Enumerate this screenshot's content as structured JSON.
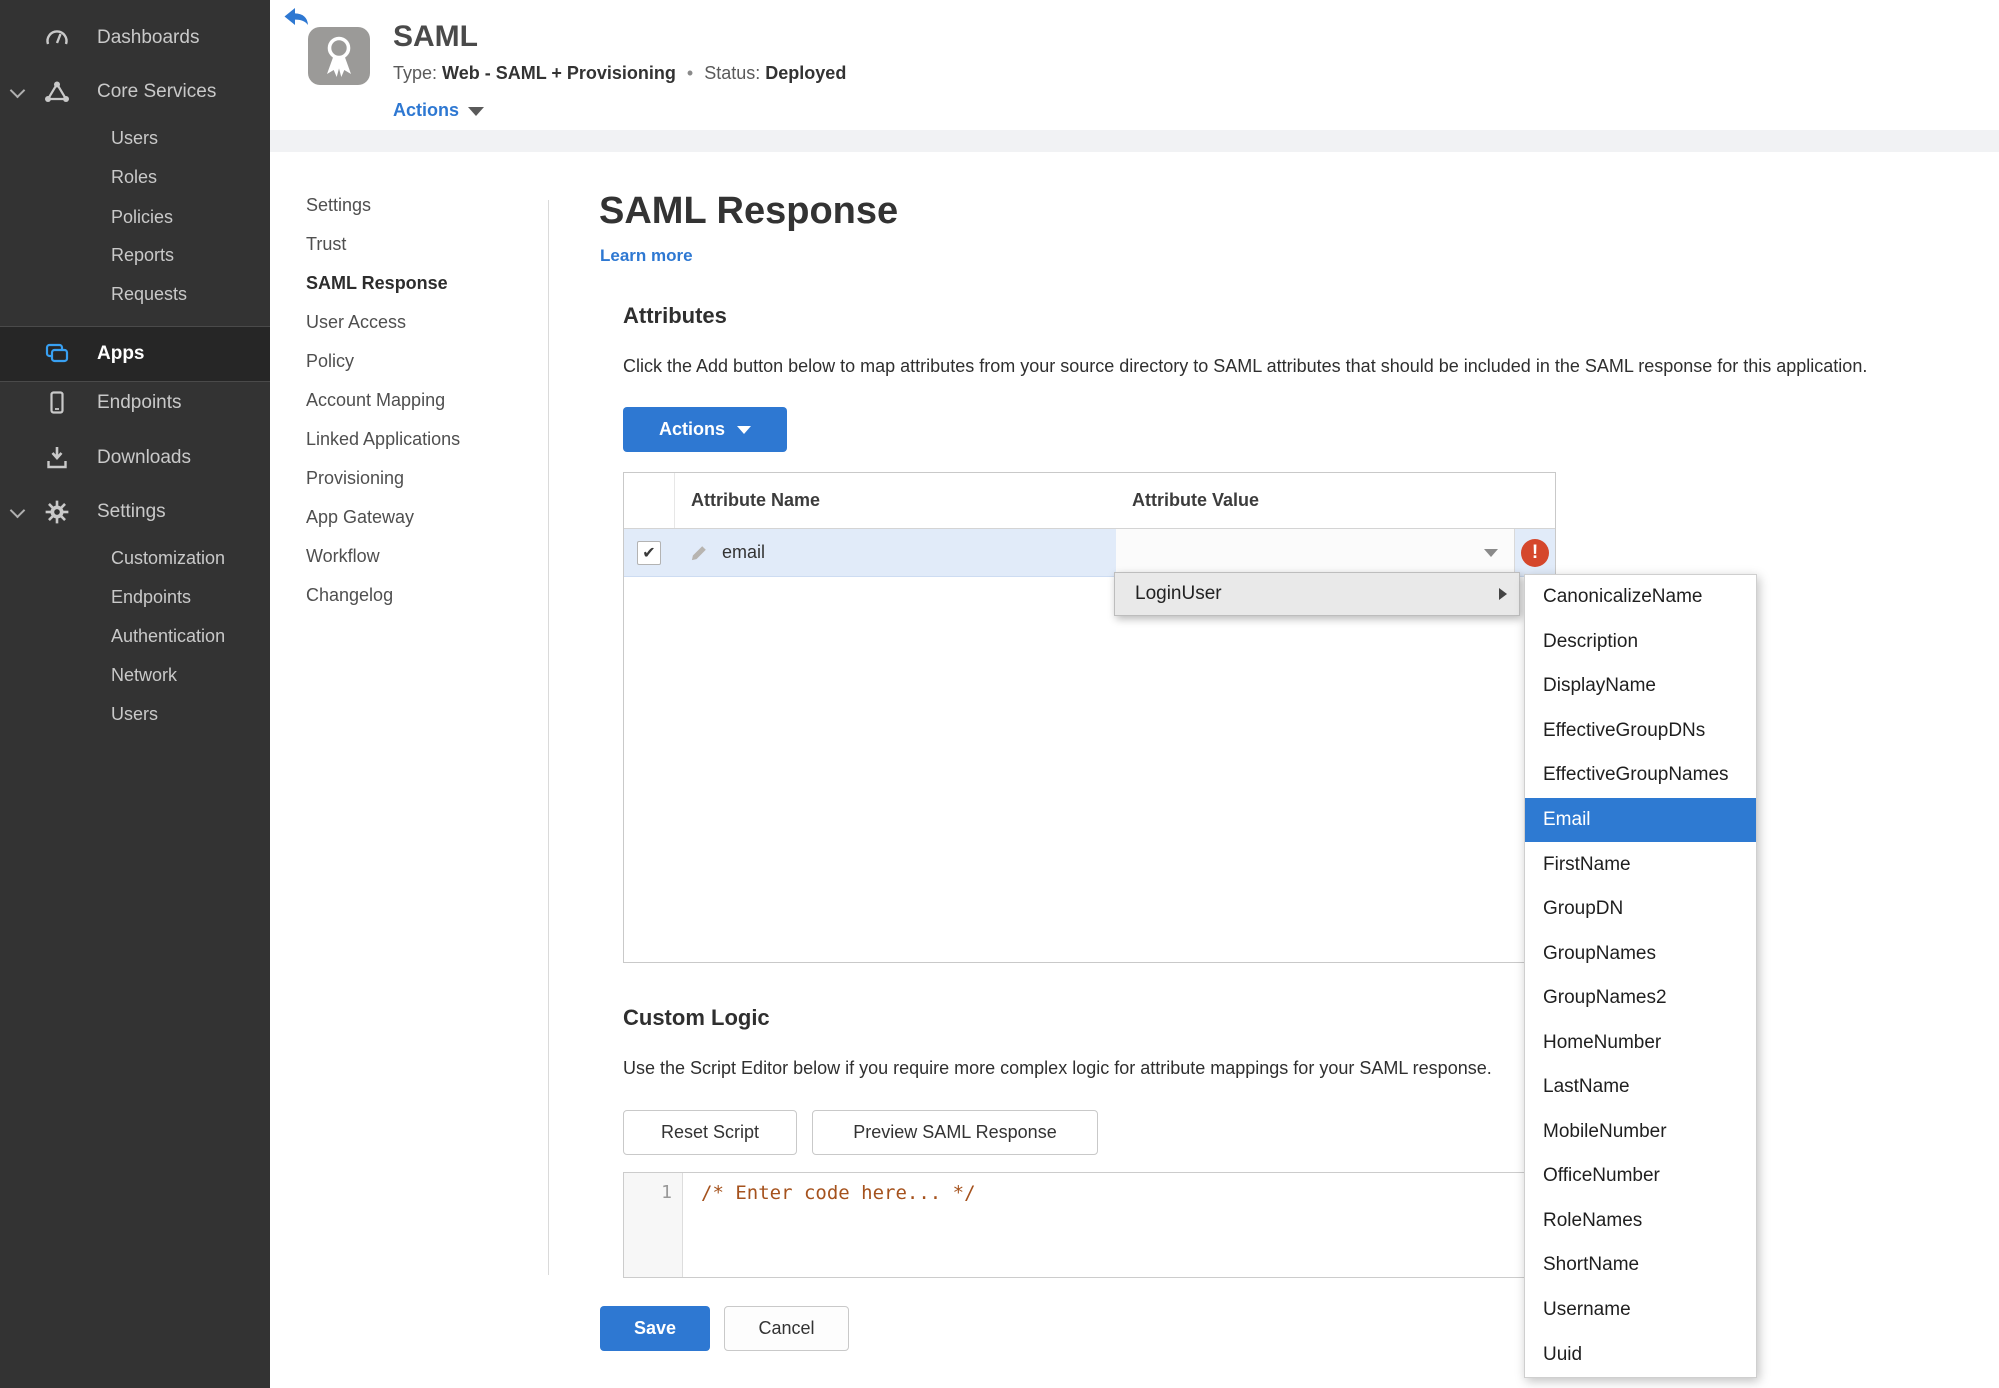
{
  "colors": {
    "accent_blue": "#2e78d2",
    "status_green": "#478b1f",
    "error_red": "#d5472c",
    "selected_row_blue": "#e1ebf9",
    "menu_highlight_blue": "#2e7ad2",
    "sidebar_bg": "#333333",
    "code_comment_orange": "#a5521d"
  },
  "icons": {
    "check": "✔",
    "error": "!"
  },
  "sidebar": {
    "items": [
      {
        "label": "Dashboards",
        "icon": "gauge-icon"
      },
      {
        "label": "Core Services",
        "icon": "core-services-icon",
        "expanded": true
      },
      {
        "label": "Users",
        "indent": true
      },
      {
        "label": "Roles",
        "indent": true
      },
      {
        "label": "Policies",
        "indent": true
      },
      {
        "label": "Reports",
        "indent": true
      },
      {
        "label": "Requests",
        "indent": true
      },
      {
        "label": "Apps",
        "icon": "apps-icon",
        "active": true
      },
      {
        "label": "Endpoints",
        "icon": "mobile-icon"
      },
      {
        "label": "Downloads",
        "icon": "download-icon"
      },
      {
        "label": "Settings",
        "icon": "gear-icon",
        "expanded": true
      },
      {
        "label": "Customization",
        "indent": true
      },
      {
        "label": "Endpoints",
        "indent": true
      },
      {
        "label": "Authentication",
        "indent": true
      },
      {
        "label": "Network",
        "indent": true
      },
      {
        "label": "Users",
        "indent": true
      }
    ]
  },
  "header": {
    "app_title": "SAML",
    "type_label": "Type:",
    "type_value": "Web - SAML + Provisioning",
    "separator": "•",
    "status_label": "Status:",
    "status_value": "Deployed",
    "actions_label": "Actions"
  },
  "subnav": {
    "active": "SAML Response",
    "items": [
      "Settings",
      "Trust",
      "SAML Response",
      "User Access",
      "Policy",
      "Account Mapping",
      "Linked Applications",
      "Provisioning",
      "App Gateway",
      "Workflow",
      "Changelog"
    ]
  },
  "main": {
    "title": "SAML Response",
    "learn_more": "Learn more",
    "attributes": {
      "heading": "Attributes",
      "description": "Click the Add button below to map attributes from your source directory to SAML attributes that should be included in the SAML response for this application.",
      "actions_button": "Actions",
      "table": {
        "columns": [
          "Attribute Name",
          "Attribute Value"
        ],
        "rows": [
          {
            "checked": true,
            "name": "email",
            "value": ""
          }
        ]
      }
    },
    "menu": {
      "label": "LoginUser",
      "selected": "Email",
      "submenu": [
        "CanonicalizeName",
        "Description",
        "DisplayName",
        "EffectiveGroupDNs",
        "EffectiveGroupNames",
        "Email",
        "FirstName",
        "GroupDN",
        "GroupNames",
        "GroupNames2",
        "HomeNumber",
        "LastName",
        "MobileNumber",
        "OfficeNumber",
        "RoleNames",
        "ShortName",
        "Username",
        "Uuid"
      ]
    },
    "custom_logic": {
      "heading": "Custom Logic",
      "description": "Use the Script Editor below if you require more complex logic for attribute mappings for your SAML response.",
      "reset_button": "Reset Script",
      "preview_button": "Preview SAML Response",
      "editor": {
        "line_number": "1",
        "code": "/* Enter code here... */"
      }
    },
    "footer": {
      "save": "Save",
      "cancel": "Cancel"
    }
  }
}
